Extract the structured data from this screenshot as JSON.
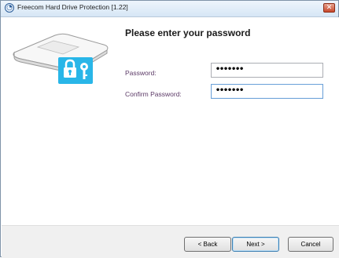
{
  "window": {
    "title": "Freecom Hard Drive Protection [1.22]",
    "close_glyph": "✕"
  },
  "main": {
    "heading": "Please enter your password",
    "password": {
      "label": "Password:",
      "value": "•••••••"
    },
    "confirm": {
      "label": "Confirm Password:",
      "value": "•••••••"
    }
  },
  "footer": {
    "back_label": "< Back",
    "next_label": "Next >",
    "cancel_label": "Cancel"
  },
  "colors": {
    "accent": "#29b6e8",
    "label": "#5c3a67"
  },
  "icons": {
    "app": "app-icon",
    "illustration": "hard-drive-lock-icon"
  }
}
